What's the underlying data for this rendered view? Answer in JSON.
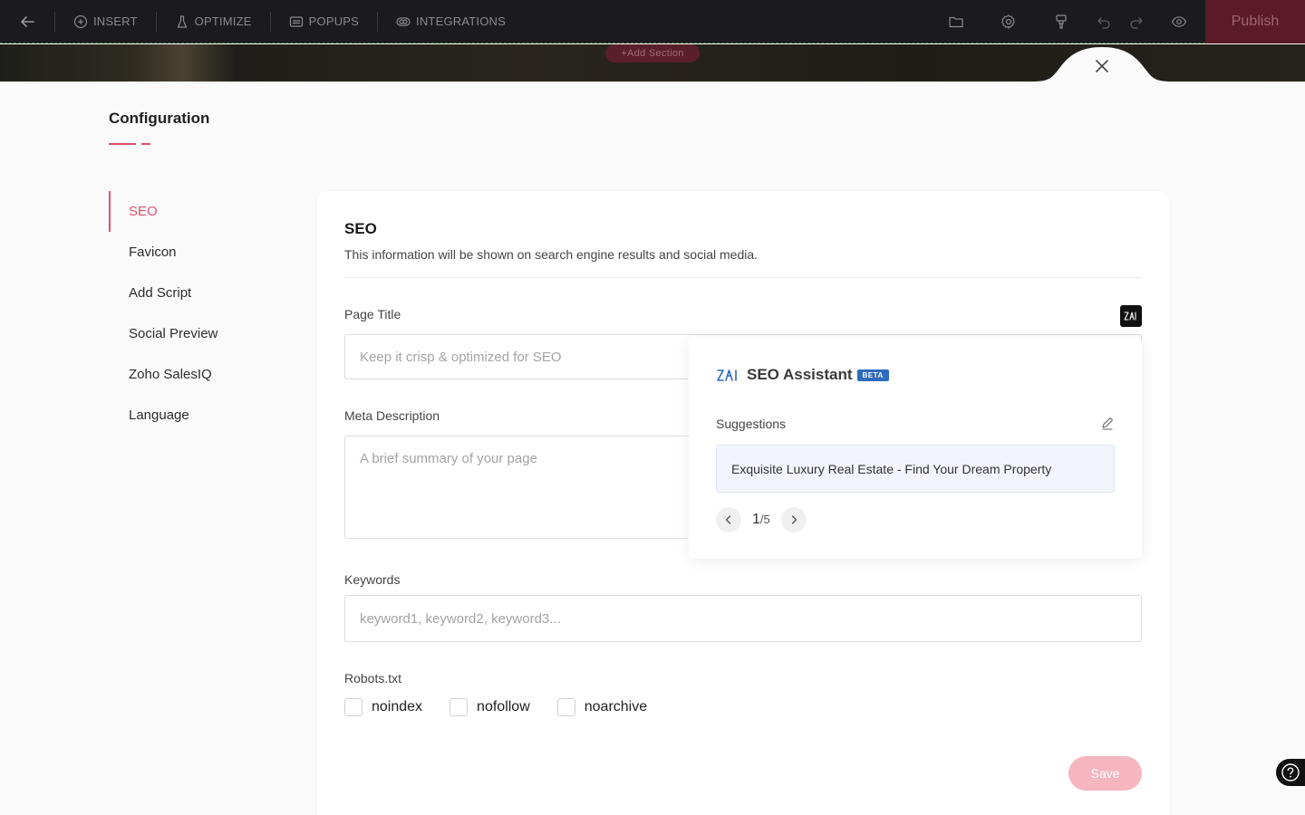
{
  "toolbar": {
    "items": [
      {
        "label": "INSERT",
        "icon": "plus-circle-icon"
      },
      {
        "label": "OPTIMIZE",
        "icon": "flask-icon"
      },
      {
        "label": "POPUPS",
        "icon": "popup-icon"
      },
      {
        "label": "INTEGRATIONS",
        "icon": "toggle-icon"
      }
    ],
    "publish_label": "Publish",
    "add_section_label": "+Add Section"
  },
  "config": {
    "title": "Configuration",
    "nav": [
      {
        "label": "SEO",
        "active": true
      },
      {
        "label": "Favicon",
        "active": false
      },
      {
        "label": "Add Script",
        "active": false
      },
      {
        "label": "Social Preview",
        "active": false
      },
      {
        "label": "Zoho SalesIQ",
        "active": false
      },
      {
        "label": "Language",
        "active": false
      }
    ]
  },
  "seo": {
    "title": "SEO",
    "subtitle": "This information will be shown on search engine results and social media.",
    "page_title": {
      "label": "Page Title",
      "placeholder": "Keep it crisp & optimized for SEO",
      "value": ""
    },
    "meta_description": {
      "label": "Meta Description",
      "placeholder": "A brief summary of your page",
      "value": ""
    },
    "keywords": {
      "label": "Keywords",
      "placeholder": "keyword1, keyword2, keyword3...",
      "value": ""
    },
    "robots": {
      "label": "Robots.txt",
      "options": [
        {
          "label": "noindex",
          "checked": false
        },
        {
          "label": "nofollow",
          "checked": false
        },
        {
          "label": "noarchive",
          "checked": false
        }
      ]
    },
    "save_label": "Save"
  },
  "assistant": {
    "title": "SEO Assistant",
    "badge": "BETA",
    "suggestions_label": "Suggestions",
    "suggestion": "Exquisite Luxury Real Estate - Find Your Dream Property",
    "current": "1",
    "total": "/5"
  },
  "colors": {
    "accent": "#e0516b",
    "toolbar_bg": "#1b1b1d",
    "publish_bg": "#5a1a26",
    "beta_badge": "#2f6bbf",
    "suggestion_bg": "#f2f5fd",
    "save_disabled": "#f5b6c0"
  }
}
